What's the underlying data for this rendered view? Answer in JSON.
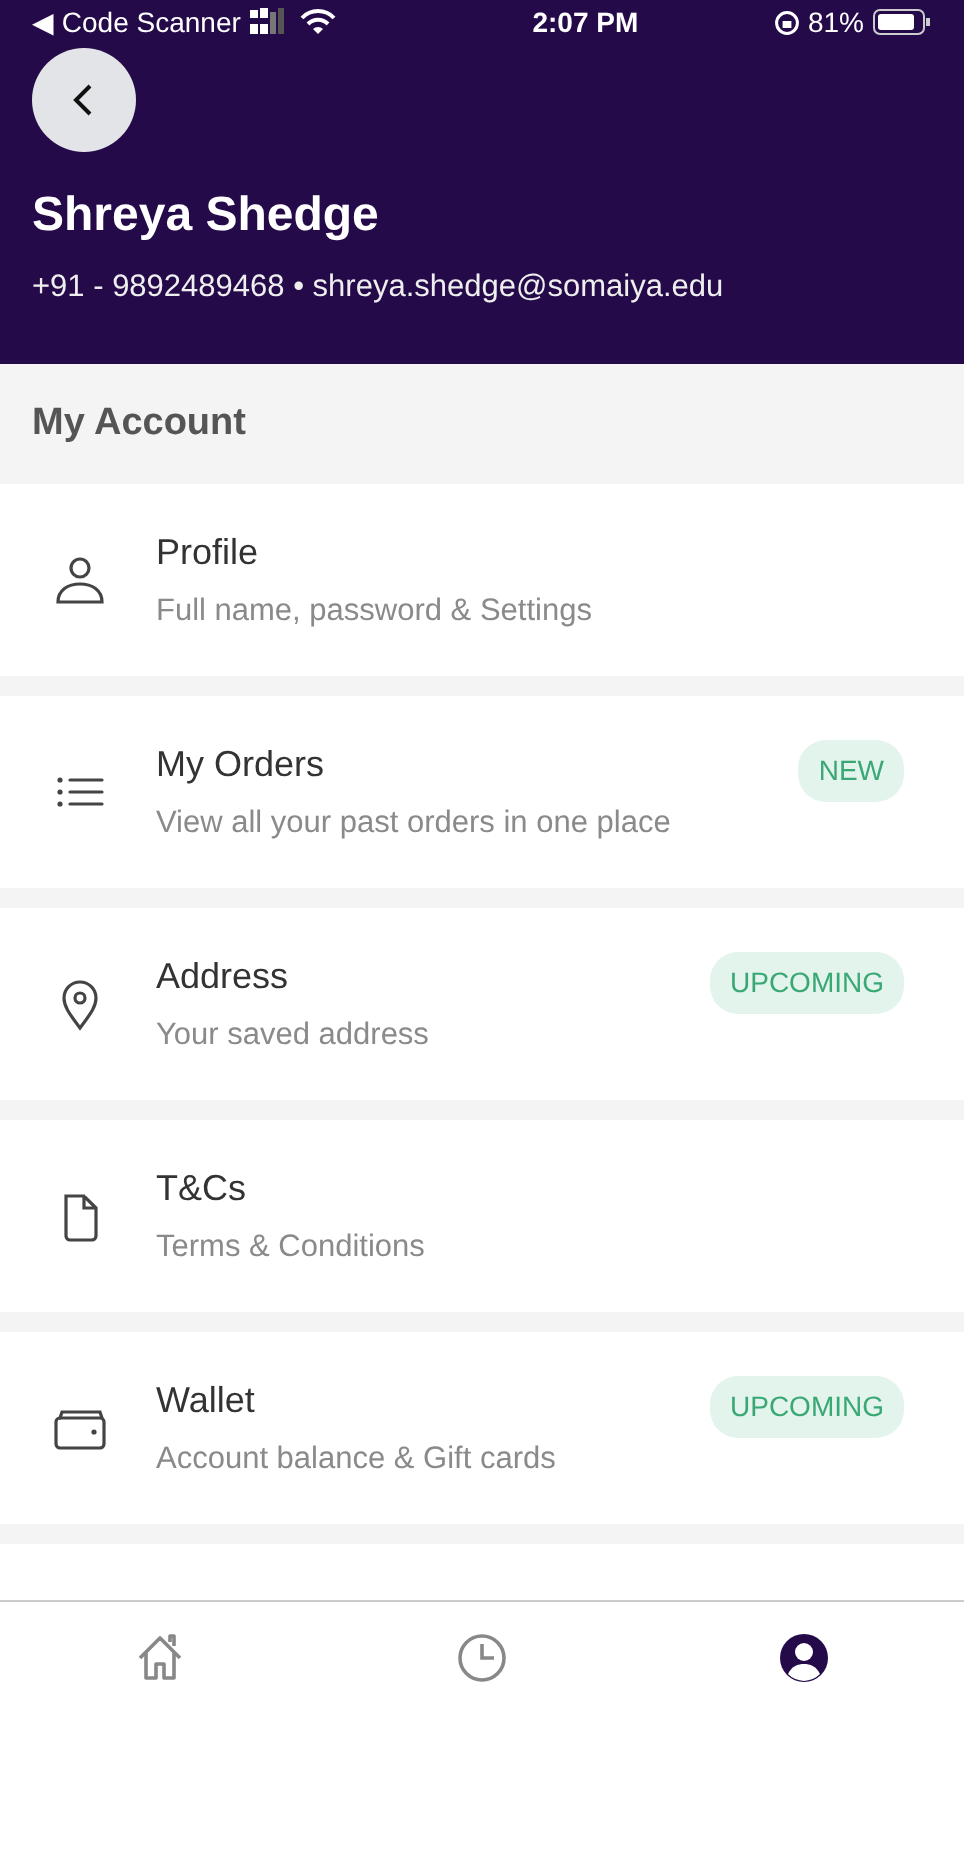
{
  "status_bar": {
    "back_app": "◀ Code Scanner",
    "time": "2:07 PM",
    "battery": "81%"
  },
  "header": {
    "name": "Shreya Shedge",
    "contact": "+91 - 9892489468 • shreya.shedge@somaiya.edu"
  },
  "section_title": "My Account",
  "menu": [
    {
      "title": "Profile",
      "subtitle": "Full name, password & Settings"
    },
    {
      "title": "My Orders",
      "subtitle": "View all your past orders in one place",
      "badge": "NEW"
    },
    {
      "title": "Address",
      "subtitle": "Your saved address",
      "badge": "UPCOMING"
    },
    {
      "title": "T&Cs",
      "subtitle": "Terms & Conditions"
    },
    {
      "title": "Wallet",
      "subtitle": "Account balance & Gift cards",
      "badge": "UPCOMING"
    }
  ],
  "bottom_nav": [
    {
      "selected": false
    },
    {
      "selected": false
    },
    {
      "selected": true
    }
  ]
}
